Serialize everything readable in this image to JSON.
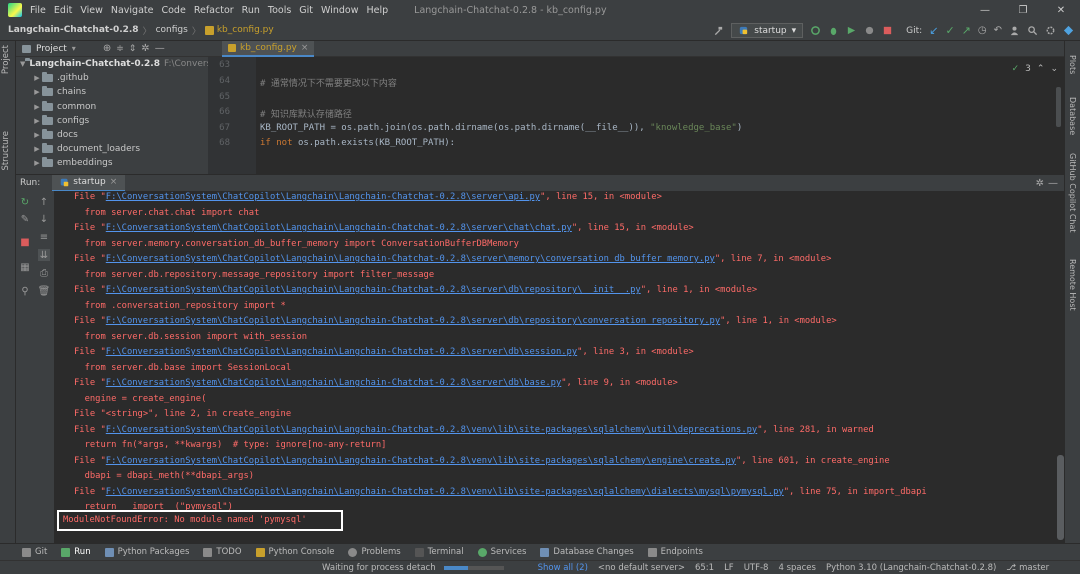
{
  "menubar": {
    "items": [
      "File",
      "Edit",
      "View",
      "Navigate",
      "Code",
      "Refactor",
      "Run",
      "Tools",
      "Git",
      "Window",
      "Help"
    ],
    "window_title": "Langchain-Chatchat-0.2.8 - kb_config.py"
  },
  "navbar": {
    "project": "Langchain-Chatchat-0.2.8",
    "folder": "configs",
    "file": "kb_config.py",
    "run_config": "startup",
    "git_label": "Git:"
  },
  "project_panel": {
    "title": "Project",
    "root": "Langchain-Chatchat-0.2.8",
    "root_path": "F:\\Convers",
    "items": [
      ".github",
      "chains",
      "common",
      "configs",
      "docs",
      "document_loaders",
      "embeddings"
    ]
  },
  "left_stripe": {
    "project": "Project",
    "structure": "Structure"
  },
  "right_stripe": {
    "plots": "Plots",
    "database": "Database",
    "copilot": "GitHub Copilot Chat",
    "remote": "Remote Host"
  },
  "editor": {
    "tab": "kb_config.py",
    "inspections": "3",
    "lines": [
      {
        "num": "63",
        "text": ""
      },
      {
        "num": "64",
        "text": "# 通常情况下不需要更改以下内容"
      },
      {
        "num": "65",
        "text": ""
      },
      {
        "num": "66",
        "text": "# 知识库默认存储路径"
      },
      {
        "num": "67",
        "text": "KB_ROOT_PATH = os.path.join(os.path.dirname(os.path.dirname(__file__)), \"knowledge_base\")"
      },
      {
        "num": "68",
        "text": "if not os.path.exists(KB_ROOT_PATH):"
      }
    ]
  },
  "run_panel": {
    "label": "Run:",
    "tab": "startup"
  },
  "console": {
    "lines": [
      {
        "pre": "File \"",
        "link": "F:\\ConversationSystem\\ChatCopilot\\Langchain\\Langchain-Chatchat-0.2.8\\server\\api.py",
        "post": "\", line 15, in <module>"
      },
      {
        "pre": "  from server.chat.chat import chat"
      },
      {
        "pre": "File \"",
        "link": "F:\\ConversationSystem\\ChatCopilot\\Langchain\\Langchain-Chatchat-0.2.8\\server\\chat\\chat.py",
        "post": "\", line 15, in <module>"
      },
      {
        "pre": "  from server.memory.conversation_db_buffer_memory import ConversationBufferDBMemory"
      },
      {
        "pre": "File \"",
        "link": "F:\\ConversationSystem\\ChatCopilot\\Langchain\\Langchain-Chatchat-0.2.8\\server\\memory\\conversation_db_buffer_memory.py",
        "post": "\", line 7, in <module>"
      },
      {
        "pre": "  from server.db.repository.message_repository import filter_message"
      },
      {
        "pre": "File \"",
        "link": "F:\\ConversationSystem\\ChatCopilot\\Langchain\\Langchain-Chatchat-0.2.8\\server\\db\\repository\\__init__.py",
        "post": "\", line 1, in <module>"
      },
      {
        "pre": "  from .conversation_repository import *"
      },
      {
        "pre": "File \"",
        "link": "F:\\ConversationSystem\\ChatCopilot\\Langchain\\Langchain-Chatchat-0.2.8\\server\\db\\repository\\conversation_repository.py",
        "post": "\", line 1, in <module>"
      },
      {
        "pre": "  from server.db.session import with_session"
      },
      {
        "pre": "File \"",
        "link": "F:\\ConversationSystem\\ChatCopilot\\Langchain\\Langchain-Chatchat-0.2.8\\server\\db\\session.py",
        "post": "\", line 3, in <module>"
      },
      {
        "pre": "  from server.db.base import SessionLocal"
      },
      {
        "pre": "File \"",
        "link": "F:\\ConversationSystem\\ChatCopilot\\Langchain\\Langchain-Chatchat-0.2.8\\server\\db\\base.py",
        "post": "\", line 9, in <module>"
      },
      {
        "pre": "  engine = create_engine("
      },
      {
        "pre": "File \"<string>\", line 2, in create_engine"
      },
      {
        "pre": "File \"",
        "link": "F:\\ConversationSystem\\ChatCopilot\\Langchain\\Langchain-Chatchat-0.2.8\\venv\\lib\\site-packages\\sqlalchemy\\util\\deprecations.py",
        "post": "\", line 281, in warned"
      },
      {
        "pre": "  return fn(*args, **kwargs)  # type: ignore[no-any-return]"
      },
      {
        "pre": "File \"",
        "link": "F:\\ConversationSystem\\ChatCopilot\\Langchain\\Langchain-Chatchat-0.2.8\\venv\\lib\\site-packages\\sqlalchemy\\engine\\create.py",
        "post": "\", line 601, in create_engine"
      },
      {
        "pre": "  dbapi = dbapi_meth(**dbapi_args)"
      },
      {
        "pre": "File \"",
        "link": "F:\\ConversationSystem\\ChatCopilot\\Langchain\\Langchain-Chatchat-0.2.8\\venv\\lib\\site-packages\\sqlalchemy\\dialects\\mysql\\pymysql.py",
        "post": "\", line 75, in import_dbapi"
      },
      {
        "pre": "  return __import__(\"pymysql\")"
      }
    ],
    "error": "ModuleNotFoundError: No module named 'pymysql'"
  },
  "bottom_tabs": [
    "Git",
    "Run",
    "Python Packages",
    "TODO",
    "Python Console",
    "Problems",
    "Terminal",
    "Services",
    "Database Changes",
    "Endpoints"
  ],
  "status": {
    "message": "Waiting for process detach",
    "show_all": "Show all (2)",
    "server": "<no default server>",
    "position": "65:1",
    "line_sep": "LF",
    "encoding": "UTF-8",
    "indent": "4 spaces",
    "interpreter": "Python 3.10 (Langchain-Chatchat-0.2.8)",
    "branch": "master"
  },
  "colors": {
    "error": "#ff6b68",
    "link": "#5394ec",
    "accent": "#4a88c7"
  }
}
